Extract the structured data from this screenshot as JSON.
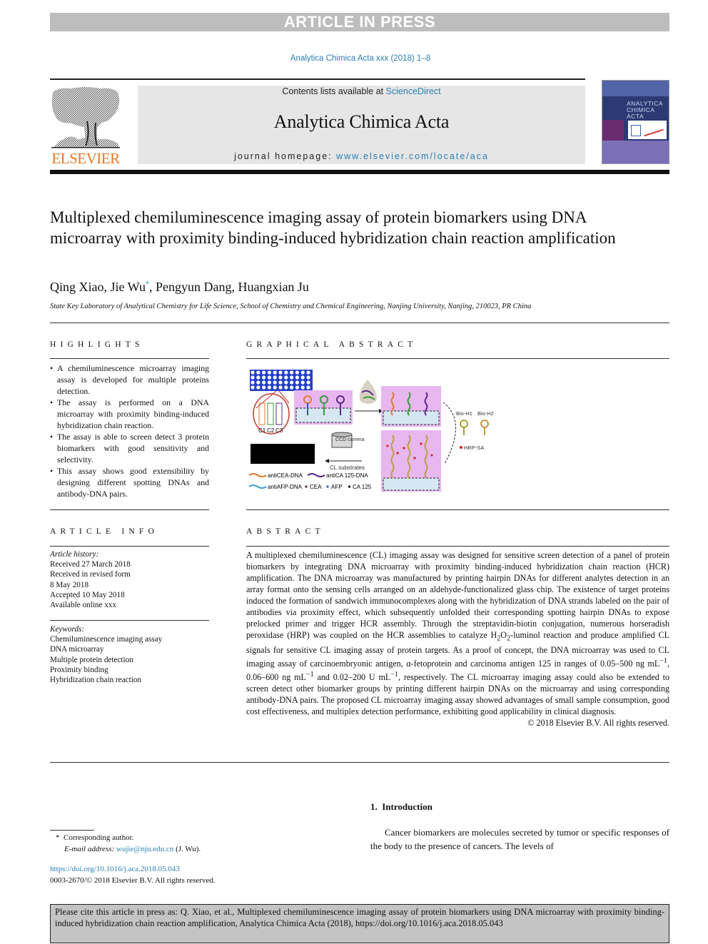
{
  "banner": {
    "text": "ARTICLE IN PRESS"
  },
  "journal_ref": "Analytica Chimica Acta xxx (2018) 1–8",
  "masthead": {
    "publisher_logo_text": "ELSEVIER",
    "contents_prefix": "Contents lists available at ",
    "contents_link": "ScienceDirect",
    "journal_name": "Analytica Chimica Acta",
    "homepage_prefix": "journal homepage: ",
    "homepage_link": "www.elsevier.com/locate/aca",
    "cover_title": "ANALYTICA CHIMICA ACTA"
  },
  "article": {
    "title": "Multiplexed chemiluminescence imaging assay of protein biomarkers using DNA microarray with proximity binding-induced hybridization chain reaction amplification",
    "authors": [
      {
        "name": "Qing Xiao",
        "mark": ""
      },
      {
        "name": "Jie Wu",
        "mark": "*"
      },
      {
        "name": "Pengyun Dang",
        "mark": ""
      },
      {
        "name": "Huangxian Ju",
        "mark": ""
      }
    ],
    "affiliation": "State Key Laboratory of Analytical Chemistry for Life Science, School of Chemistry and Chemical Engineering, Nanjing University, Nanjing, 210023, PR China"
  },
  "highlights": {
    "heading": "HIGHLIGHTS",
    "items": [
      "A chemiluminescence microarray imaging assay is developed for multiple proteins detection.",
      "The assay is performed on a DNA microarray with proximity binding-induced hybridization chain reaction.",
      "The assay is able to screen detect 3 protein biomarkers with good sensitivity and selectivity.",
      "This assay shows good extensibility by designing different spotting DNAs and antibody-DNA pairs."
    ]
  },
  "graphical_abstract": {
    "heading": "GRAPHICAL ABSTRACT",
    "labels": {
      "cells": [
        "C1",
        "C2",
        "C3"
      ],
      "ccd": "CCD camera",
      "substrates": "CL substrates",
      "bio_h1": "Bio-H1",
      "bio_h2": "Bio-H2",
      "hrp_sa": "HRP-SA"
    },
    "legend": [
      {
        "label": "antiCEA-DNA",
        "color": "#e07a2a"
      },
      {
        "label": "antiCA 125-DNA",
        "color": "#5a2a8a"
      },
      {
        "label": "antiAFP-DNA",
        "color": "#3aa0d8"
      },
      {
        "label": "CEA",
        "color": "#6a2040"
      },
      {
        "label": "AFP",
        "color": "#2060d0"
      },
      {
        "label": "CA 125",
        "color": "#222222"
      }
    ]
  },
  "article_info": {
    "heading": "ARTICLE INFO",
    "history_label": "Article history:",
    "history": [
      "Received 27 March 2018",
      "Received in revised form",
      "8 May 2018",
      "Accepted 10 May 2018",
      "Available online xxx"
    ],
    "keywords_label": "Keywords:",
    "keywords": [
      "Chemiluminescence imaging assay",
      "DNA microarray",
      "Multiple protein detection",
      "Proximity binding",
      "Hybridization chain reaction"
    ]
  },
  "abstract": {
    "heading": "ABSTRACT",
    "part1": "A multiplexed chemiluminescence (CL) imaging assay was designed for sensitive screen detection of a panel of protein biomarkers by integrating DNA microarray with proximity binding-induced hybridization chain reaction (HCR) amplification. The DNA microarray was manufactured by printing hairpin DNAs for different analytes detection in an array format onto the sensing cells arranged on an aldehyde-functionalized glass chip. The existence of target proteins induced the formation of sandwich immunocomplexes along with the hybridization of DNA strands labeled on the pair of antibodies via proximity effect, which subsequently unfolded their corresponding spotting hairpin DNAs to expose prelocked primer and trigger HCR assembly. Through the streptavidin-biotin conjugation, numerous horseradish peroxidase (HRP) was coupled on the HCR assemblies to catalyze H",
    "h2o2_sub1": "2",
    "h2o2_mid": "O",
    "h2o2_sub2": "2",
    "part2": "-luminol reaction and produce amplified CL signals for sensitive CL imaging assay of protein targets. As a proof of concept, the DNA microarray was used to CL imaging assay of carcinoembryonic antigen, α-fetoprotein and carcinoma antigen 125 in ranges of 0.05–500 ng mL",
    "sup": "−1",
    "part3": ", 0.06–600 ng mL",
    "part4": " and 0.02–200 U mL",
    "part5": ", respectively. The CL microarray imaging assay could also be extended to screen detect other biomarker groups by printing different hairpin DNAs on the microarray and using corresponding antibody-DNA pairs. The proposed CL microarray imaging assay showed advantages of small sample consumption, good cost effectiveness, and multiplex detection performance, exhibiting good applicability in clinical diagnosis.",
    "copyright": "© 2018 Elsevier B.V. All rights reserved."
  },
  "introduction": {
    "heading": "1.  Introduction",
    "text": "Cancer biomarkers are molecules secreted by tumor or specific responses of the body to the presence of cancers. The levels of"
  },
  "footnotes": {
    "star": "*",
    "corresponding": "Corresponding author.",
    "email_label": "E-mail address: ",
    "email": "wujie@nju.edu.cn",
    "email_suffix": " (J. Wu).",
    "doi": "https://doi.org/10.1016/j.aca.2018.05.043",
    "issn": "0003-2670/© 2018 Elsevier B.V. All rights reserved."
  },
  "citation": {
    "text": "Please cite this article in press as: Q. Xiao, et al., Multiplexed chemiluminescence imaging assay of protein biomarkers using DNA microarray with proximity binding-induced hybridization chain reaction amplification, Analytica Chimica Acta (2018), https://doi.org/10.1016/j.aca.2018.05.043"
  }
}
